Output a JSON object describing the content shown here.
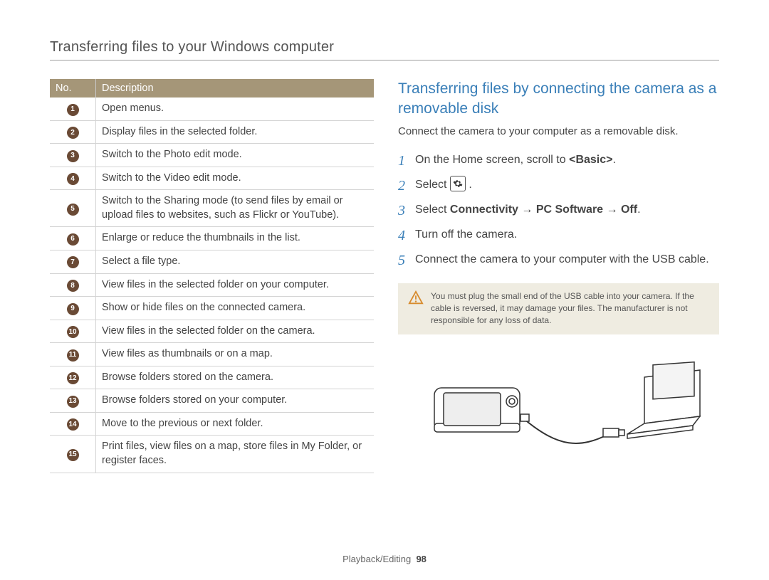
{
  "header": {
    "topic_title": "Transferring files to your Windows computer"
  },
  "table": {
    "header_no": "No.",
    "header_desc": "Description",
    "rows": [
      {
        "n": "1",
        "desc": "Open menus."
      },
      {
        "n": "2",
        "desc": "Display files in the selected folder."
      },
      {
        "n": "3",
        "desc": "Switch to the Photo edit mode."
      },
      {
        "n": "4",
        "desc": "Switch to the Video edit mode."
      },
      {
        "n": "5",
        "desc": "Switch to the Sharing mode (to send files by email or upload files to websites, such as Flickr or YouTube)."
      },
      {
        "n": "6",
        "desc": "Enlarge or reduce the thumbnails in the list."
      },
      {
        "n": "7",
        "desc": "Select a file type."
      },
      {
        "n": "8",
        "desc": "View files in the selected folder on your computer."
      },
      {
        "n": "9",
        "desc": "Show or hide files on the connected camera."
      },
      {
        "n": "10",
        "desc": "View files in the selected folder on the camera."
      },
      {
        "n": "11",
        "desc": "View files as thumbnails or on a map."
      },
      {
        "n": "12",
        "desc": "Browse folders stored on the camera."
      },
      {
        "n": "13",
        "desc": "Browse folders stored on your computer."
      },
      {
        "n": "14",
        "desc": "Move to the previous or next folder."
      },
      {
        "n": "15",
        "desc": "Print files, view files on a map, store files in My Folder, or register faces."
      }
    ]
  },
  "right": {
    "heading": "Transferring files by connecting the camera as a removable disk",
    "intro": "Connect the camera to your computer as a removable disk.",
    "steps": {
      "s1_pre": "On the Home screen, scroll to ",
      "s1_bold": "<Basic>",
      "s1_post": ".",
      "s2_pre": "Select ",
      "s2_post": ".",
      "s3_pre": "Select ",
      "s3_bold": "Connectivity → PC Software → Off",
      "s3_post": ".",
      "s4": "Turn off the camera.",
      "s5": "Connect the camera to your computer with the USB cable."
    },
    "note": "You must plug the small end of the USB cable into your camera. If the cable is reversed, it may damage your files. The manufacturer is not responsible for any loss of data."
  },
  "footer": {
    "section": "Playback/Editing",
    "page": "98"
  }
}
